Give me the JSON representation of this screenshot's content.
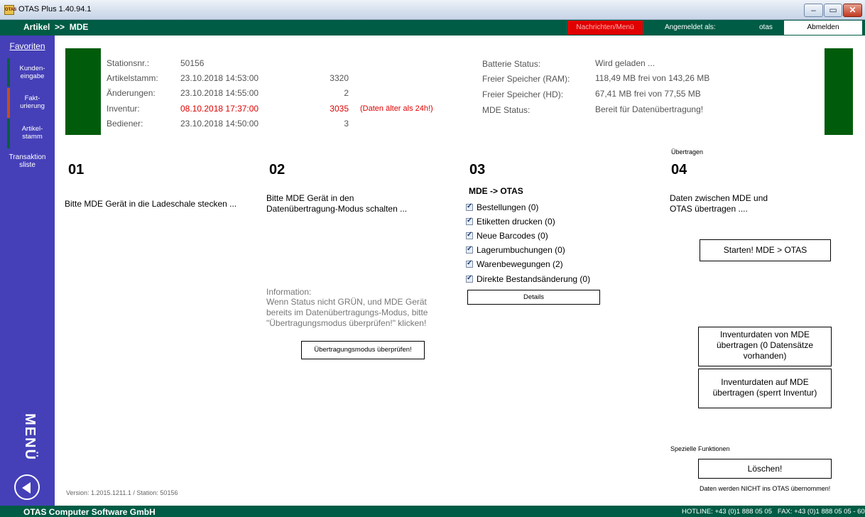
{
  "window": {
    "title": "OTAS Plus 1.40.94.1",
    "app_icon": "OTAS"
  },
  "header": {
    "breadcrumb": "Artikel  >>  MDE",
    "messages_button": "Nachrichten/Menü",
    "logged_in_label": "Angemeldet als:",
    "username": "otas",
    "logout_button": "Abmelden"
  },
  "sidebar": {
    "favorites": "Favoriten",
    "items": [
      {
        "label": "Kunden-\neingabe"
      },
      {
        "label": "Fakt-\nurierung"
      },
      {
        "label": "Artikel-\nstamm"
      },
      {
        "label": "Transaktion\nsliste"
      }
    ],
    "menu_label": "MENÜ"
  },
  "status_left": {
    "station_label": "Stationsnr.:",
    "station_value": "50156",
    "artikelstamm_label": "Artikelstamm:",
    "artikelstamm_date": "23.10.2018 14:53:00",
    "artikelstamm_count": "3320",
    "aenderungen_label": "Änderungen:",
    "aenderungen_date": "23.10.2018 14:55:00",
    "aenderungen_count": "2",
    "inventur_label": "Inventur:",
    "inventur_date": "08.10.2018 17:37:00",
    "inventur_count": "3035",
    "inventur_warning": "(Daten älter als 24h!)",
    "bediener_label": "Bediener:",
    "bediener_date": "23.10.2018 14:50:00",
    "bediener_count": "3"
  },
  "status_right": {
    "battery_label": "Batterie Status:",
    "battery_value": "Wird geladen ...",
    "ram_label": "Freier Speicher (RAM):",
    "ram_value": "118,49 MB frei von 143,26 MB",
    "hd_label": "Freier Speicher (HD):",
    "hd_value": "67,41 MB frei von 77,55 MB",
    "mde_label": "MDE Status:",
    "mde_value": "Bereit für Datenübertragung!"
  },
  "steps": {
    "s1": {
      "num": "01",
      "text": "Bitte MDE Gerät in die Ladeschale stecken ..."
    },
    "s2": {
      "num": "02",
      "text": "Bitte MDE Gerät in den\nDatenübertragung-Modus schalten ...",
      "info_title": "Information:",
      "info_text": "Wenn Status nicht GRÜN, und MDE Gerät\nbereits im Datenübertragungs-Modus, bitte\n\"Übertragungsmodus überprüfen!\" klicken!",
      "check_button": "Übertragungsmodus überprüfen!"
    },
    "s3": {
      "num": "03",
      "direction": "MDE -> OTAS",
      "checkboxes": [
        "Bestellungen (0)",
        "Etiketten drucken (0)",
        "Neue Barcodes (0)",
        "Lagerumbuchungen (0)",
        "Warenbewegungen (2)",
        "Direkte Bestandsänderung (0)"
      ],
      "details_button": "Details"
    },
    "s4": {
      "caption": "Übertragen",
      "num": "04",
      "text": "Daten zwischen MDE und\nOTAS übertragen ....",
      "start_button": "Starten! MDE > OTAS",
      "inventur_from_button": "Inventurdaten von MDE\nübertragen (0 Datensätze\nvorhanden)",
      "inventur_to_button": "Inventurdaten auf MDE\nübertragen (sperrt Inventur)",
      "special_label": "Spezielle Funktionen",
      "delete_button": "Löschen!",
      "delete_note": "Daten werden NICHT ins OTAS übernommen!"
    }
  },
  "version": "Version: 1.2015.1211.1 / Station: 50156",
  "footer": {
    "company": "OTAS Computer Software GmbH",
    "hotline": "HOTLINE: +43 (0)1 888 05 05   FAX: +43 (0)1 888 05 05 - 60"
  },
  "colors": {
    "header_green": "#005c45",
    "status_green": "#005c0a",
    "sidebar": "#4540b8",
    "alert_red": "#e00000"
  }
}
